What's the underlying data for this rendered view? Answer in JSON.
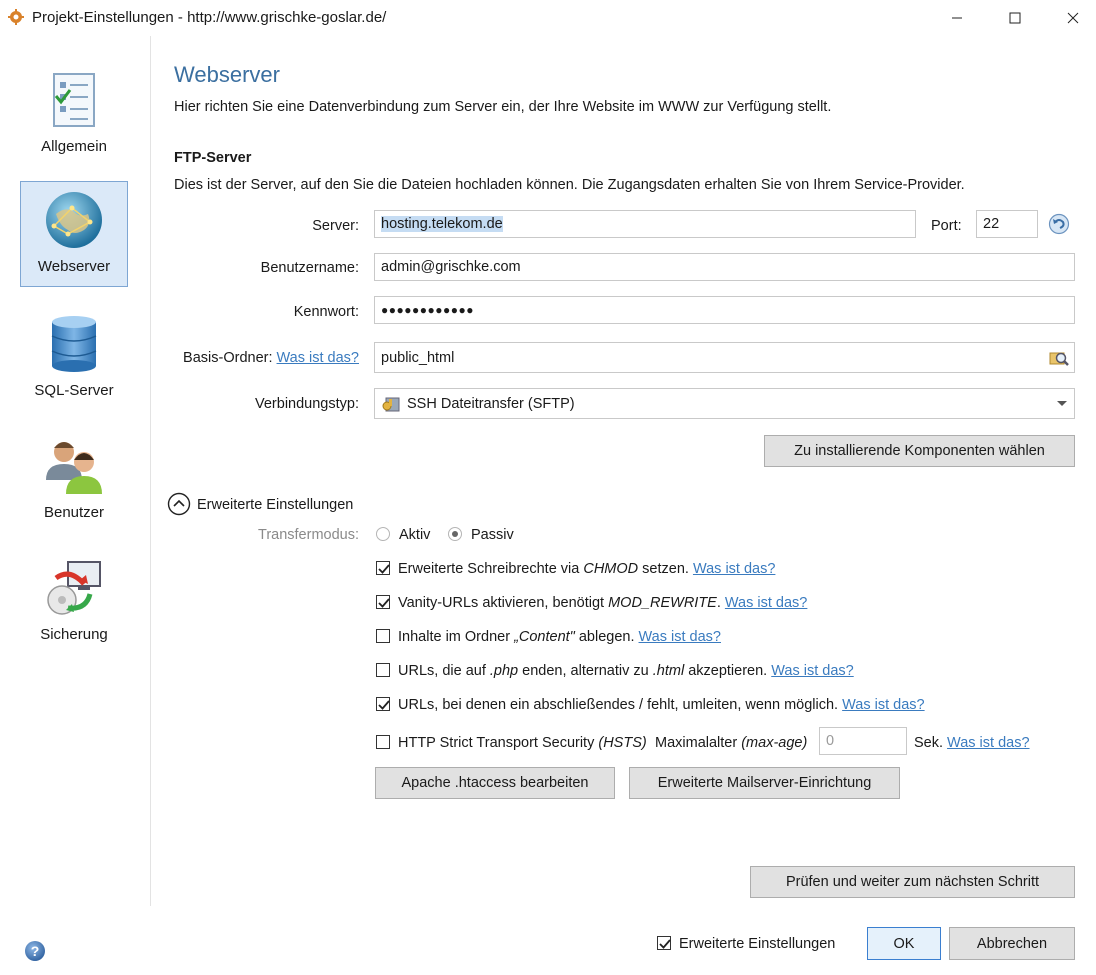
{
  "window": {
    "title": "Projekt-Einstellungen - http://www.grischke-goslar.de/",
    "minimize_icon": "minimize-icon",
    "maximize_icon": "maximize-icon",
    "close_icon": "close-icon"
  },
  "sidebar": {
    "items": [
      {
        "label": "Allgemein",
        "icon": "checklist-icon"
      },
      {
        "label": "Webserver",
        "icon": "globe-icon"
      },
      {
        "label": "SQL-Server",
        "icon": "database-icon"
      },
      {
        "label": "Benutzer",
        "icon": "users-icon"
      },
      {
        "label": "Sicherung",
        "icon": "backup-icon"
      }
    ]
  },
  "page": {
    "title": "Webserver",
    "description": "Hier richten Sie eine Datenverbindung zum Server ein, der Ihre Website im WWW zur Verfügung stellt."
  },
  "ftp": {
    "heading": "FTP-Server",
    "description": "Dies ist der Server, auf den Sie die Dateien hochladen können. Die Zugangsdaten erhalten Sie von Ihrem Service-Provider.",
    "server_label": "Server:",
    "server_value": "hosting.telekom.de",
    "port_label": "Port:",
    "port_value": "22",
    "username_label": "Benutzername:",
    "username_value": "admin@grischke.com",
    "password_label": "Kennwort:",
    "password_value": "●●●●●●●●●●●●",
    "base_folder_label": "Basis-Ordner:",
    "base_folder_help": "Was ist das?",
    "base_folder_value": "public_html",
    "connection_type_label": "Verbindungstyp:",
    "connection_type_value": "SSH Dateitransfer (SFTP)",
    "components_button": "Zu installierende Komponenten wählen"
  },
  "advanced": {
    "toggle_label": "Erweiterte Einstellungen",
    "transfer_mode_label": "Transfermodus:",
    "mode_active": "Aktiv",
    "mode_passive": "Passiv",
    "selected_mode": "Passiv",
    "help_link": "Was ist das?",
    "options": [
      {
        "checked": true,
        "pre": "Erweiterte Schreibrechte via ",
        "em": "CHMOD",
        "post": " setzen."
      },
      {
        "checked": true,
        "pre": "Vanity-URLs aktivieren, benötigt ",
        "em": "MOD_REWRITE",
        "post": "."
      },
      {
        "checked": false,
        "pre": "Inhalte im Ordner ",
        "em": "„Content\"",
        "post": " ablegen."
      },
      {
        "checked": false,
        "pre": "URLs, die auf ",
        "em": ".php",
        "post": " enden, alternativ zu ",
        "em2": ".html",
        "post2": " akzeptieren."
      },
      {
        "checked": true,
        "pre": "URLs, bei denen ein abschließendes / fehlt, umleiten, wenn möglich.",
        "em": "",
        "post": ""
      }
    ],
    "hsts": {
      "checked": false,
      "label_pre": "HTTP Strict Transport Security ",
      "label_em": "(HSTS)",
      "max_age_pre": "Maximalalter ",
      "max_age_em": "(max-age)",
      "max_age_placeholder": "0",
      "unit": "Sek."
    },
    "htaccess_button": "Apache .htaccess bearbeiten",
    "mailserver_button": "Erweiterte Mailserver-Einrichtung"
  },
  "footer": {
    "check_next_button": "Prüfen und weiter zum nächsten Schritt",
    "advanced_checkbox_label": "Erweiterte Einstellungen",
    "advanced_checked": true,
    "ok_button": "OK",
    "cancel_button": "Abbrechen",
    "help_icon": "help-icon"
  },
  "colors": {
    "accent": "#3b6fa0",
    "link": "#3a7bbf",
    "selection": "#c5dcf3",
    "active_nav_bg": "#dbe9f8"
  }
}
